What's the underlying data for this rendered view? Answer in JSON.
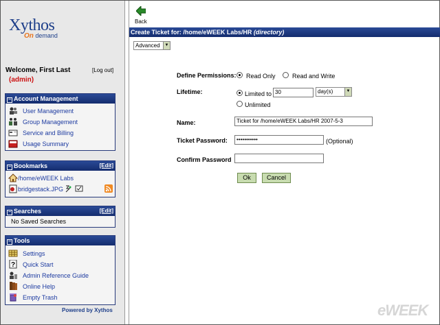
{
  "logo": {
    "main": "Xythos",
    "sub_on": "On",
    "sub_rest": " demand"
  },
  "welcome": {
    "greeting": "Welcome, First Last",
    "role": "(admin)",
    "logout": "[Log out]"
  },
  "account": {
    "title": "Account Management",
    "items": [
      {
        "label": "User Management",
        "icon": "users-icon"
      },
      {
        "label": "Group Management",
        "icon": "group-icon"
      },
      {
        "label": "Service and Billing",
        "icon": "billing-icon"
      },
      {
        "label": "Usage Summary",
        "icon": "usage-icon"
      }
    ]
  },
  "bookmarks": {
    "title": "Bookmarks",
    "edit": "[Edit]",
    "items": [
      {
        "label": "/home/eWEEK Labs",
        "icon": "home-icon"
      },
      {
        "label": "bridgestack.JPG",
        "icon": "image-file-icon"
      }
    ]
  },
  "searches": {
    "title": "Searches",
    "edit": "[Edit]",
    "empty": "No Saved Searches"
  },
  "tools": {
    "title": "Tools",
    "items": [
      {
        "label": "Settings",
        "icon": "settings-icon"
      },
      {
        "label": "Quick Start",
        "icon": "help-icon"
      },
      {
        "label": "Admin Reference Guide",
        "icon": "guide-icon"
      },
      {
        "label": "Online Help",
        "icon": "book-icon"
      },
      {
        "label": "Empty Trash",
        "icon": "trash-icon"
      }
    ]
  },
  "powered": "Powered by Xythos",
  "toolbar": {
    "back": "Back"
  },
  "ticket": {
    "title_prefix": "Create Ticket for:  /home/eWEEK Labs/HR",
    "title_suffix": "(directory)",
    "mode": "Advanced",
    "permissions_label": "Define Permissions:",
    "perm_read_only": "Read Only",
    "perm_read_write": "Read and Write",
    "lifetime_label": "Lifetime:",
    "limited_to": "Limited to",
    "limited_value": "30",
    "unit": "day(s)",
    "unlimited": "Unlimited",
    "name_label": "Name:",
    "name_value": "Ticket for /home/eWEEK Labs/HR 2007-5-3",
    "password_label": "Ticket Password:",
    "password_value": "•••••••••••",
    "optional": "(Optional)",
    "confirm_label": "Confirm Password",
    "confirm_value": "",
    "ok": "Ok",
    "cancel": "Cancel"
  },
  "watermark": "eWEEK"
}
